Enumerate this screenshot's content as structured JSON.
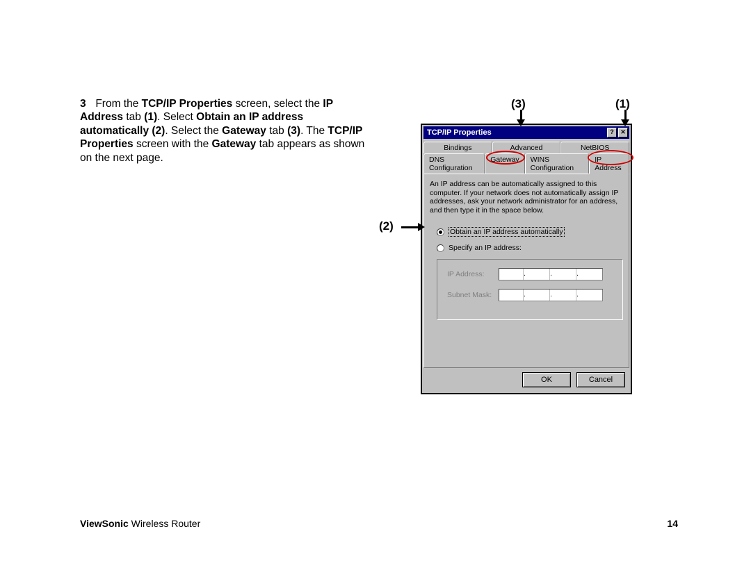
{
  "step_number": "3",
  "instruction": {
    "p1a": "From the ",
    "b1": "TCP/IP Properties",
    "p1b": " screen, select the ",
    "b2": "IP Address",
    "p1c": " tab ",
    "b3": "(1)",
    "p1d": ". Select ",
    "b4": "Obtain an IP address automatically (2)",
    "p1e": ". Select the ",
    "b5": "Gateway",
    "p1f": " tab ",
    "b6": "(3)",
    "p1g": ". The ",
    "b7": "TCP/IP Properties",
    "p1h": " screen with the ",
    "b8": "Gateway",
    "p1i": " tab appears as shown on the next page."
  },
  "callouts": {
    "c1": "(1)",
    "c2": "(2)",
    "c3": "(3)"
  },
  "dialog": {
    "title": "TCP/IP Properties",
    "help_btn": "?",
    "close_btn": "✕",
    "tabs_top": [
      "Bindings",
      "Advanced",
      "NetBIOS"
    ],
    "tabs_bottom": [
      "DNS Configuration",
      "Gateway",
      "WINS Configuration",
      "IP Address"
    ],
    "description": "An IP address can be automatically assigned to this computer. If your network does not automatically assign IP addresses, ask your network administrator for an address, and then type it in the space below.",
    "radio_auto": "Obtain an IP address automatically",
    "radio_specify": "Specify an IP address:",
    "ip_label": "IP Address:",
    "subnet_label": "Subnet Mask:",
    "ok": "OK",
    "cancel": "Cancel"
  },
  "footer": {
    "brand": "ViewSonic",
    "product": " Wireless Router",
    "page": "14"
  }
}
